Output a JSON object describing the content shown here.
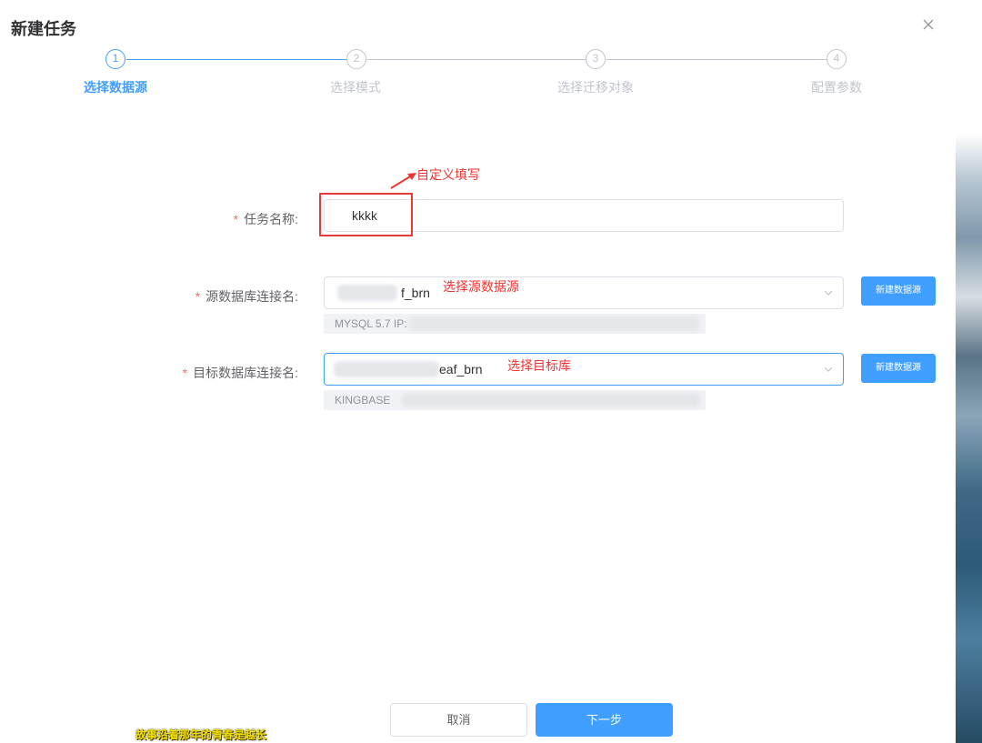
{
  "dialog": {
    "title": "新建任务"
  },
  "steps": [
    {
      "number": "1",
      "label": "选择数据源",
      "active": true
    },
    {
      "number": "2",
      "label": "选择模式",
      "active": false
    },
    {
      "number": "3",
      "label": "选择迁移对象",
      "active": false
    },
    {
      "number": "4",
      "label": "配置参数",
      "active": false
    }
  ],
  "form": {
    "task_name": {
      "label": "任务名称:",
      "value": "kkkk"
    },
    "source_conn": {
      "label": "源数据库连接名:",
      "value_suffix": "f_brn",
      "info": "MYSQL 5.7 IP:",
      "new_button": "新建数据源"
    },
    "target_conn": {
      "label": "目标数据库连接名:",
      "value_suffix": "eaf_brn",
      "info": "KINGBASE",
      "new_button": "新建数据源"
    }
  },
  "annotations": {
    "custom_fill": "自定义填写",
    "select_source": "选择源数据源",
    "select_target": "选择目标库"
  },
  "footer": {
    "cancel": "取消",
    "next": "下一步"
  },
  "watermark": "故事沿着那年的青春是越长",
  "colors": {
    "primary": "#409eff",
    "required": "#f56c6c",
    "annotation": "#f03232"
  }
}
